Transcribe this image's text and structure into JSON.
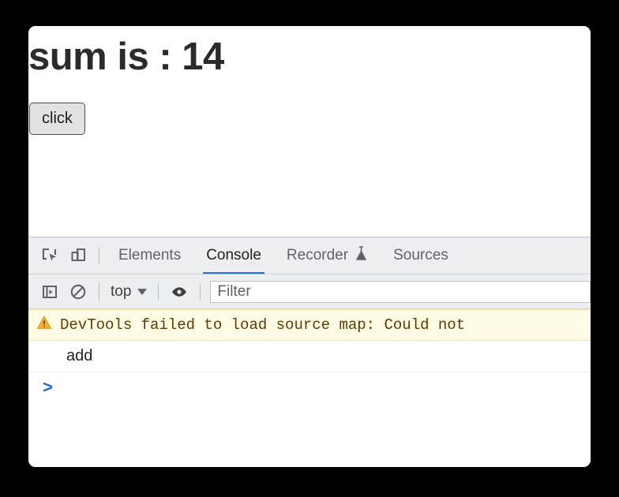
{
  "window": {
    "page": {
      "heading": "sum is : 14",
      "button_label": "click"
    }
  },
  "devtools": {
    "tabbar": {
      "inspect_icon": "inspect-element-icon",
      "device_icon": "device-toolbar-icon",
      "tabs": [
        {
          "label": "Elements",
          "active": false
        },
        {
          "label": "Console",
          "active": true
        },
        {
          "label": "Recorder",
          "active": false,
          "icon": "flask-icon"
        },
        {
          "label": "Sources",
          "active": false
        }
      ]
    },
    "toolbar": {
      "sidebar_icon": "console-sidebar-icon",
      "clear_icon": "clear-console-icon",
      "context_value": "top",
      "eye_icon": "live-expression-eye-icon",
      "filter_placeholder": "Filter",
      "filter_value": ""
    },
    "console": {
      "messages": [
        {
          "level": "warning",
          "icon": "warning-triangle-icon",
          "text": "DevTools failed to load source map: Could not"
        },
        {
          "level": "log",
          "text": "add"
        }
      ],
      "prompt_chevron": ">",
      "prompt_value": ""
    }
  },
  "colors": {
    "accent_blue": "#1a73e8",
    "prompt_blue": "#2864e8",
    "warning_bg": "#fffbe5",
    "warning_text": "#5c3c00",
    "warning_icon": "#e8a33d",
    "toolbar_bg": "#eceff1",
    "backdrop": "#000000"
  }
}
